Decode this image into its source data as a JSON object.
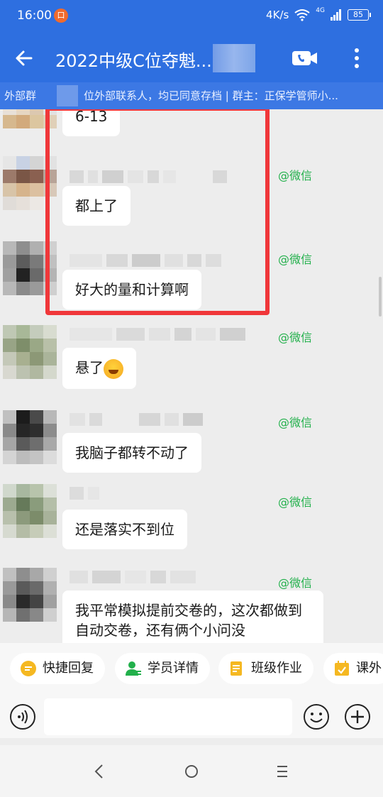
{
  "status_bar": {
    "time": "16:00",
    "notification_badge": "口",
    "network_speed": "4K/s",
    "signal": "4G",
    "battery": "85"
  },
  "header": {
    "title": "2022中级C位夺魁..."
  },
  "notice": {
    "prefix": "外部群",
    "text": "位外部联系人，均已同意存档 | 群主：正保学管师小..."
  },
  "messages": [
    {
      "source": "",
      "text": "6-13"
    },
    {
      "source": "@微信",
      "text": "都上了"
    },
    {
      "source": "@微信",
      "text": "好大的量和计算啊"
    },
    {
      "source": "@微信",
      "text": "悬了",
      "emoji": "crying-face-icon"
    },
    {
      "source": "@微信",
      "text": "我脑子都转不动了"
    },
    {
      "source": "@微信",
      "text": "还是落实不到位"
    },
    {
      "source": "@微信",
      "text": "我平常模拟提前交卷的，这次都做到自动交卷，还有俩个小问没"
    }
  ],
  "quick_actions": [
    {
      "label": "快捷回复",
      "icon": "quick-reply-icon"
    },
    {
      "label": "学员详情",
      "icon": "student-detail-icon"
    },
    {
      "label": "班级作业",
      "icon": "homework-icon"
    },
    {
      "label": "课外",
      "icon": "extracurricular-icon"
    }
  ],
  "input": {
    "value": "",
    "placeholder": ""
  },
  "colors": {
    "brand": "#2e6fe0",
    "notice": "#3c78e4",
    "source_green": "#22b04b",
    "highlight_red": "#f0373a"
  }
}
